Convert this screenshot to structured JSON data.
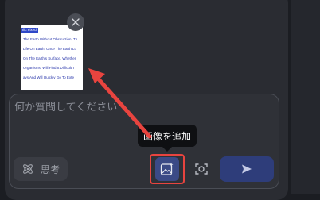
{
  "attachment": {
    "thumbnail_lines": [
      "Ilic Fixed",
      "The Earth Without Obstruction, Th",
      "Life On Earth, Once The Earth Lo",
      "On The Earth's Surface, Whether",
      "Organisms, Will Find It Difficult T",
      "ays And Will Quickly Go To Exte"
    ],
    "close_icon": "close-icon"
  },
  "input": {
    "placeholder": "何か質問してください"
  },
  "toolbar": {
    "think_label": "思考",
    "think_icon": "atom-icon",
    "image_icon": "image-add-icon",
    "camera_icon": "camera-icon",
    "send_icon": "send-icon"
  },
  "tooltip": {
    "text": "画像を追加"
  },
  "colors": {
    "highlight_box": "#e8443f",
    "arrow": "#e8443f",
    "send_button": "#2e3d7a",
    "image_button": "#3b4a86"
  }
}
